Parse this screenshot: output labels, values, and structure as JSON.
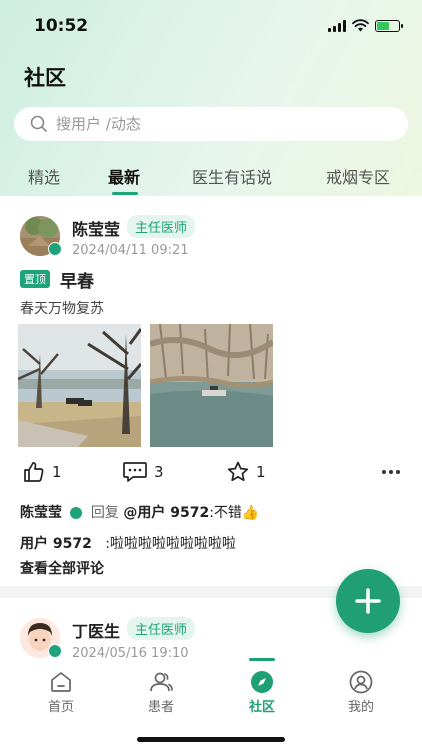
{
  "status_bar": {
    "time": "10:52"
  },
  "header": {
    "title": "社区"
  },
  "search": {
    "placeholder": "搜用户 /动态"
  },
  "tabs": [
    {
      "label": "精选",
      "active": false
    },
    {
      "label": "最新",
      "active": true
    },
    {
      "label": "医生有话说",
      "active": false
    },
    {
      "label": "戒烟专区",
      "active": false
    }
  ],
  "posts": [
    {
      "author": "陈莹莹",
      "role": "主任医师",
      "time": "2024/04/11 09:21",
      "pinned_label": "置顶",
      "title": "早春",
      "body": "春天万物复苏",
      "likes": "1",
      "comments_count": "3",
      "favorites": "1",
      "comments": [
        {
          "user": "陈莹莹",
          "action": "回复",
          "target": "@用户 9572",
          "text": ":不错👍"
        },
        {
          "user": "用户 9572",
          "text": ":啦啦啦啦啦啦啦啦啦"
        }
      ],
      "view_all": "查看全部评论"
    },
    {
      "author": "丁医生",
      "role": "主任医师",
      "time": "2024/05/16 19:10"
    }
  ],
  "bottom_nav": [
    {
      "label": "首页",
      "icon": "home-icon",
      "active": false
    },
    {
      "label": "患者",
      "icon": "patients-icon",
      "active": false
    },
    {
      "label": "社区",
      "icon": "community-icon",
      "active": true
    },
    {
      "label": "我的",
      "icon": "profile-icon",
      "active": false
    }
  ],
  "colors": {
    "accent": "#1f9f73",
    "tag_bg": "#e3f5ed"
  }
}
